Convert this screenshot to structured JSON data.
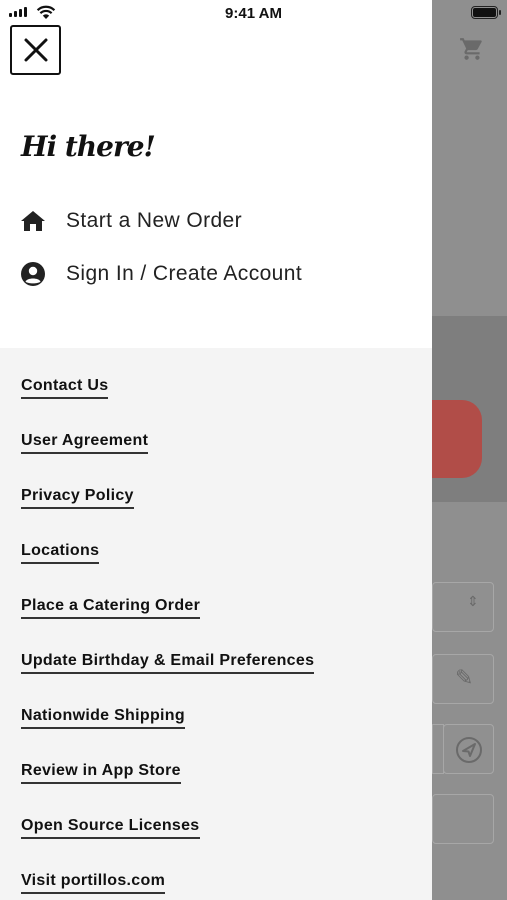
{
  "status_bar": {
    "time": "9:41 AM"
  },
  "drawer": {
    "greeting": "Hi there!",
    "primary_items": [
      {
        "label": "Start a New Order",
        "icon": "home-icon"
      },
      {
        "label": "Sign In / Create Account",
        "icon": "account-circle-icon"
      }
    ],
    "links": [
      "Contact Us",
      "User Agreement",
      "Privacy Policy",
      "Locations",
      "Place a Catering Order",
      "Update Birthday & Email Preferences",
      "Nationwide Shipping",
      "Review in App Store",
      "Open Source Licenses",
      "Visit portillos.com"
    ]
  },
  "colors": {
    "overlay": "#8f8f8f",
    "drawer_top": "#ffffff",
    "drawer_bottom": "#f4f4f4",
    "text": "#111111",
    "accent_red": "#b14d48"
  }
}
